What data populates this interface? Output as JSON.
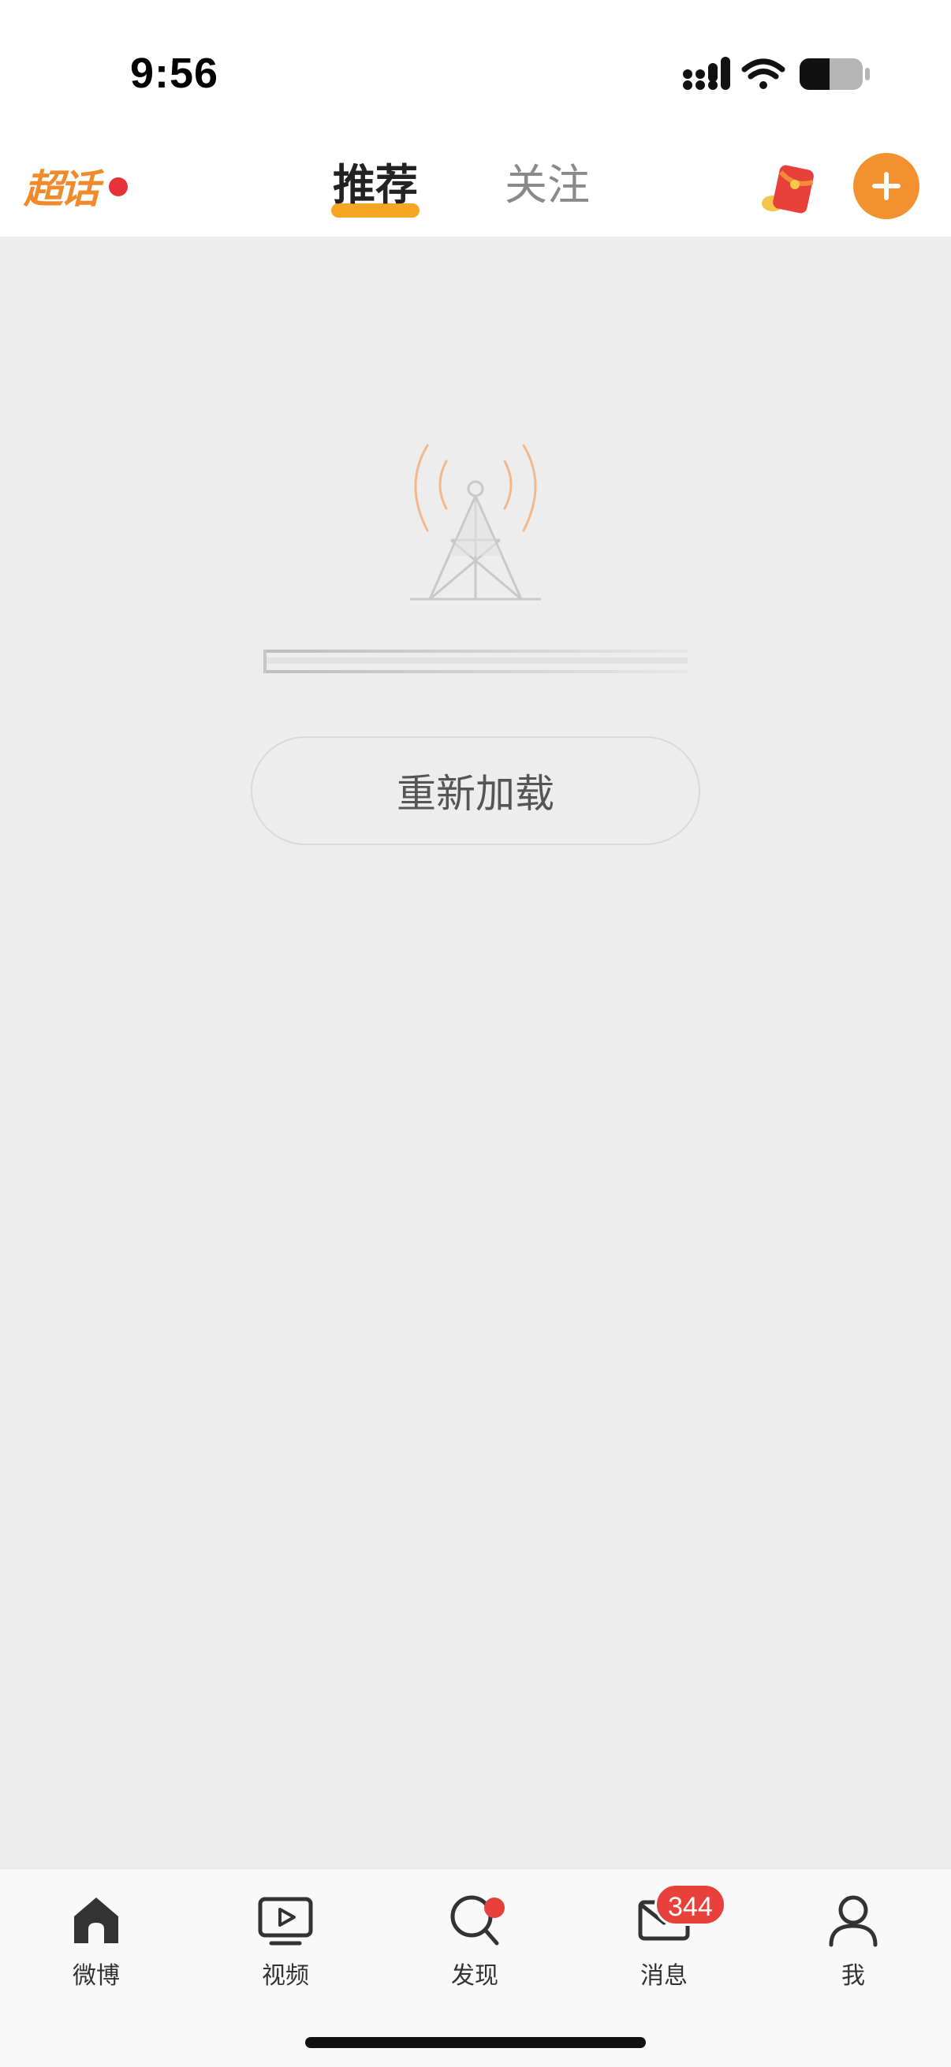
{
  "status_bar": {
    "time": "9:56"
  },
  "top_nav": {
    "chaohua_label": "超话",
    "tabs": [
      {
        "label": "推荐",
        "active": true
      },
      {
        "label": "关注",
        "active": false
      }
    ],
    "add_symbol": "+"
  },
  "error_state": {
    "reload_label": "重新加载"
  },
  "bottom_tabs": [
    {
      "label": "微博",
      "icon": "home-icon"
    },
    {
      "label": "视频",
      "icon": "video-icon"
    },
    {
      "label": "发现",
      "icon": "search-icon"
    },
    {
      "label": "消息",
      "icon": "mail-icon",
      "badge": "344"
    },
    {
      "label": "我",
      "icon": "user-icon"
    }
  ],
  "colors": {
    "accent": "#f3902f",
    "badge": "#e8403b",
    "background": "#ededed"
  }
}
